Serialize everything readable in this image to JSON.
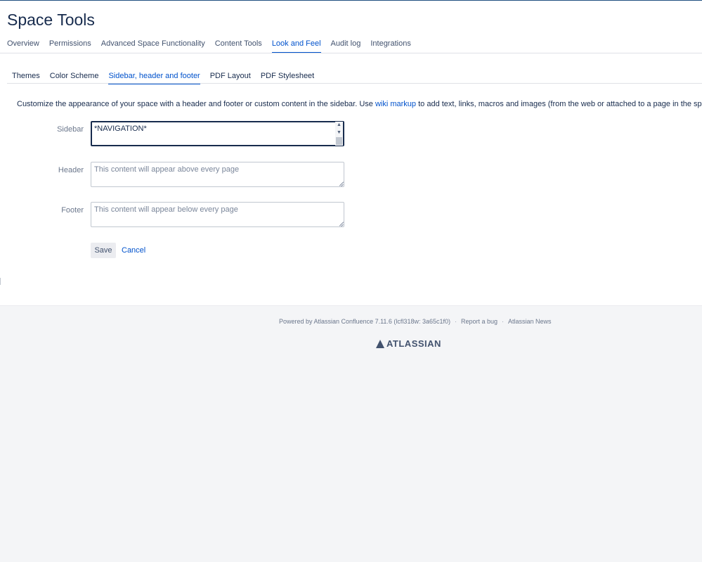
{
  "page": {
    "title": "Space Tools"
  },
  "main_nav": {
    "tabs": [
      {
        "label": "Overview"
      },
      {
        "label": "Permissions"
      },
      {
        "label": "Advanced Space Functionality"
      },
      {
        "label": "Content Tools"
      },
      {
        "label": "Look and Feel",
        "active": true
      },
      {
        "label": "Audit log"
      },
      {
        "label": "Integrations"
      }
    ]
  },
  "sub_nav": {
    "tabs": [
      {
        "label": "Themes"
      },
      {
        "label": "Color Scheme"
      },
      {
        "label": "Sidebar, header and footer",
        "active": true
      },
      {
        "label": "PDF Layout"
      },
      {
        "label": "PDF Stylesheet"
      }
    ]
  },
  "description": {
    "before": "Customize the appearance of your space with a header and footer or custom content in the sidebar. Use ",
    "link": "wiki markup",
    "after": " to add text, links, macros and images (from the web or attached to a page in the space)"
  },
  "form": {
    "sidebar": {
      "label": "Sidebar",
      "value": "*NAVIGATION*"
    },
    "header": {
      "label": "Header",
      "placeholder": "This content will appear above every page"
    },
    "footer": {
      "label": "Footer",
      "placeholder": "This content will appear below every page"
    },
    "save_label": "Save",
    "cancel_label": "Cancel"
  },
  "footer": {
    "powered_by": "Powered by Atlassian Confluence 7.11.6 (lcfl318w: 3a65c1f0)",
    "separator": "·",
    "report_bug": "Report a bug",
    "news": "Atlassian News",
    "brand": "ATLASSIAN"
  },
  "colors": {
    "accent": "#0052cc",
    "text": "#172b4d",
    "footer_bg": "#f4f5f7"
  }
}
